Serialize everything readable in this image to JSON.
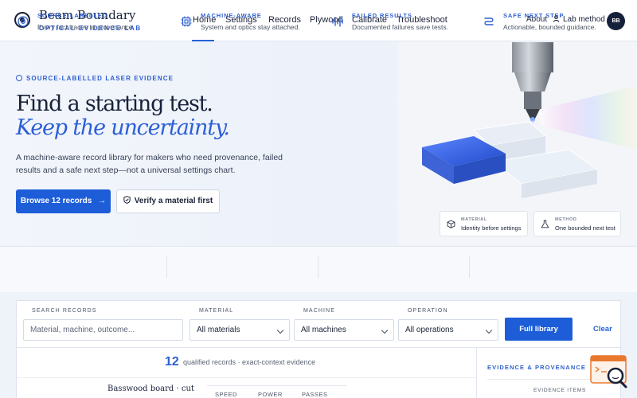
{
  "brand": {
    "name": "Beam Boundary",
    "tagline": "OPTICAL EVIDENCE LAB"
  },
  "nav": {
    "items": [
      {
        "label": "Home",
        "active": true
      },
      {
        "label": "Settings"
      },
      {
        "label": "Records"
      },
      {
        "label": "Plywood"
      },
      {
        "label": "Calibrate"
      },
      {
        "label": "Troubleshoot"
      }
    ],
    "about": "About",
    "lab_method": "Lab method",
    "avatar_initials": "BB"
  },
  "hero": {
    "eyebrow": "SOURCE-LABELLED LASER EVIDENCE",
    "headline_line1": "Find a starting test.",
    "headline_line2": "Keep the uncertainty.",
    "lede": "A machine-aware record library for makers who need provenance, failed results and a safe next step—not a universal settings chart.",
    "primary_cta": "Browse 12 records",
    "secondary_cta": "Verify a material first",
    "cards": [
      {
        "kicker": "MATERIAL",
        "text": "Identity before settings"
      },
      {
        "kicker": "METHOD",
        "text": "One bounded next test"
      }
    ]
  },
  "features": [
    {
      "title": "SOURCE-LABELLED",
      "desc": "Every fact traces to provenance.",
      "icon": "target-icon"
    },
    {
      "title": "MACHINE-AWARE",
      "desc": "System and optics stay attached.",
      "icon": "chip-icon"
    },
    {
      "title": "FAILED RESULTS",
      "desc": "Documented failures save tests.",
      "icon": "signal-bars-icon"
    },
    {
      "title": "SAFE NEXT STEP",
      "desc": "Actionable, bounded guidance.",
      "icon": "route-icon"
    }
  ],
  "search": {
    "search_label": "SEARCH RECORDS",
    "search_placeholder": "Material, machine, outcome...",
    "material_label": "MATERIAL",
    "material_value": "All materials",
    "machine_label": "MACHINE",
    "machine_value": "All machines",
    "operation_label": "OPERATION",
    "operation_value": "All operations",
    "full_library": "Full library",
    "clear": "Clear"
  },
  "results": {
    "count": "12",
    "count_text": "qualified records · exact-context evidence",
    "first_record_title": "Basswood board · cut",
    "columns": [
      "SPEED",
      "POWER",
      "PASSES"
    ]
  },
  "sidebar": {
    "title": "EVIDENCE & PROVENANCE",
    "subtitle": "EVIDENCE ITEMS"
  },
  "colors": {
    "accent": "#1d5ed8",
    "navy": "#17213a",
    "eyebrow": "#2e5fd0"
  }
}
